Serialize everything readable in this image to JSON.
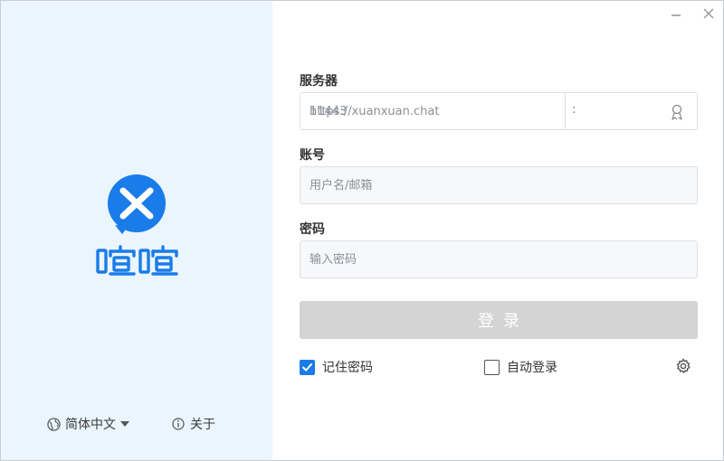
{
  "window": {
    "minimize_icon": "minimize-icon",
    "close_icon": "close-icon"
  },
  "brand": {
    "name": "喧喧",
    "accent_color": "#1a7ce8"
  },
  "footer": {
    "language_label": "简体中文",
    "about_label": "关于"
  },
  "form": {
    "server_label": "服务器",
    "server_url_placeholder": "https://xuanxuan.chat",
    "server_port_placeholder": "11443",
    "port_separator": ":",
    "account_label": "账号",
    "account_placeholder": "用户名/邮箱",
    "password_label": "密码",
    "password_placeholder": "输入密码",
    "login_button": "登录",
    "remember_password_label": "记住密码",
    "remember_password_checked": true,
    "auto_login_label": "自动登录",
    "auto_login_checked": false
  }
}
